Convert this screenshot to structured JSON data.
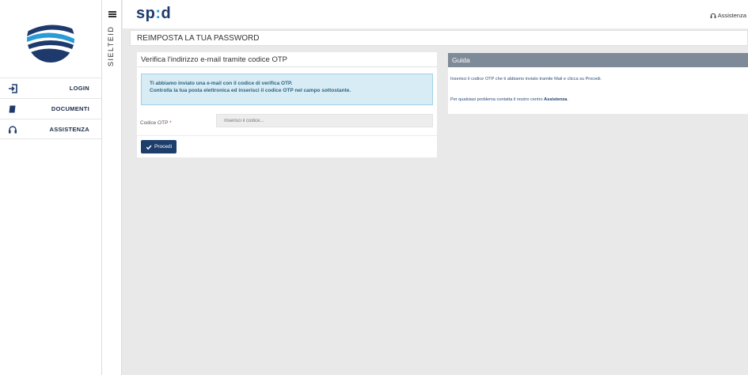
{
  "brand": {
    "name_prefix": "sp",
    "name_dot": ":",
    "name_suffix": "d"
  },
  "header": {
    "assist_label": "Assistenza"
  },
  "sidebar": {
    "items": [
      {
        "label": "LOGIN",
        "icon": "login-icon"
      },
      {
        "label": "DOCUMENTI",
        "icon": "book-icon"
      },
      {
        "label": "ASSISTENZA",
        "icon": "headset-icon"
      }
    ]
  },
  "rail": {
    "text": "SIELTEID"
  },
  "page": {
    "title": "REIMPOSTA LA TUA PASSWORD"
  },
  "verify": {
    "title": "Verifica l'indirizzo e-mail tramite codice OTP",
    "alert_line1": "Ti abbiamo inviato una e-mail con il codice di verifica OTP.",
    "alert_line2": "Controlla la tua posta elettronica ed inserisci il codice OTP nel campo sottostante.",
    "field_label": "Codice OTP",
    "field_required": "*",
    "field_placeholder": "Inserisci il codice...",
    "field_value": "",
    "button_label": "Procedi"
  },
  "guide": {
    "title": "Guida",
    "text1": "Inserisci il codice OTP che ti abbiamo inviato tramite Mail e clicca su Procedi.",
    "text2_prefix": "Per qualsiasi problema contatta il nostro centro",
    "text2_link": "Assistenza",
    "text2_suffix": "."
  },
  "colors": {
    "brand": "#1e3a6d",
    "accent": "#2a9bd6",
    "button": "#1d3d6b",
    "guide_header": "#7f8a98",
    "alert_bg": "#d8ecf5"
  }
}
